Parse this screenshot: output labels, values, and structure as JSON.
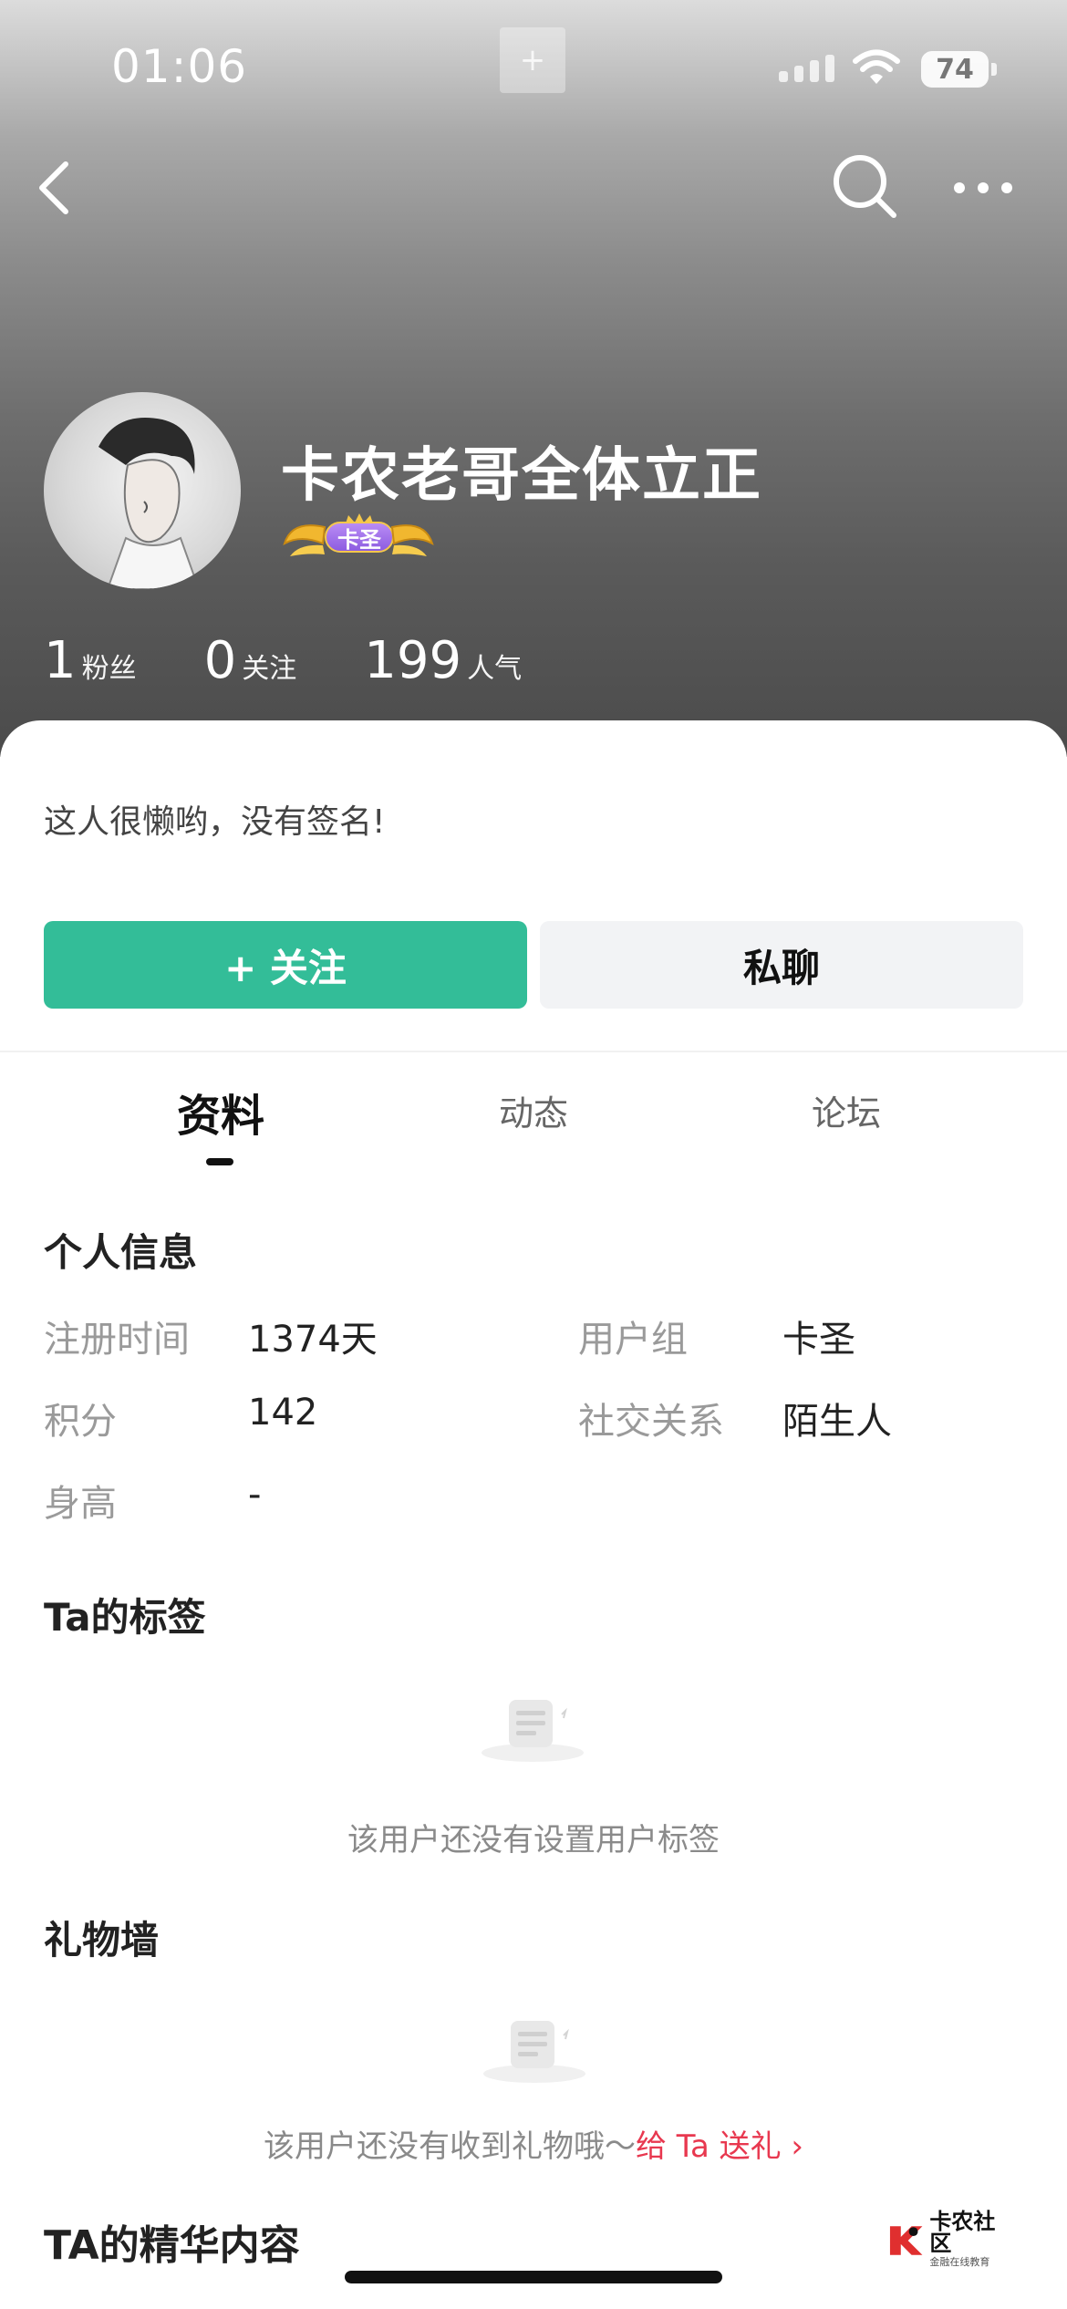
{
  "status_bar": {
    "time": "01:06",
    "battery": "74",
    "center_glyph": "+"
  },
  "nav": {
    "back_icon": "chevron-left-icon",
    "search_icon": "search-icon",
    "more_icon": "more-dots-icon"
  },
  "profile": {
    "nickname": "卡农老哥全体立正",
    "badge_label": "卡圣",
    "stats": [
      {
        "num": "1",
        "label": "粉丝"
      },
      {
        "num": "0",
        "label": "关注"
      },
      {
        "num": "199",
        "label": "人气"
      }
    ],
    "signature": "这人很懒哟，没有签名!"
  },
  "actions": {
    "follow_label": "+ 关注",
    "chat_label": "私聊"
  },
  "tabs": [
    {
      "label": "资料",
      "active": true
    },
    {
      "label": "动态",
      "active": false
    },
    {
      "label": "论坛",
      "active": false
    }
  ],
  "personal_info": {
    "title": "个人信息",
    "rows": [
      {
        "label": "注册时间",
        "value": "1374天"
      },
      {
        "label": "用户组",
        "value": "卡圣"
      },
      {
        "label": "积分",
        "value": "142"
      },
      {
        "label": "社交关系",
        "value": "陌生人"
      },
      {
        "label": "身高",
        "value": "-"
      }
    ]
  },
  "tags": {
    "title": "Ta的标签",
    "empty_text": "该用户还没有设置用户标签"
  },
  "gifts": {
    "title": "礼物墙",
    "empty_text": "该用户还没有收到礼物哦～",
    "link_text": "给 Ta 送礼 ›"
  },
  "essence": {
    "title": "TA的精华内容"
  },
  "watermark": {
    "name": "卡农社区",
    "sub": "金融在线教育"
  },
  "colors": {
    "accent": "#33bd98",
    "link": "#e8384f"
  }
}
